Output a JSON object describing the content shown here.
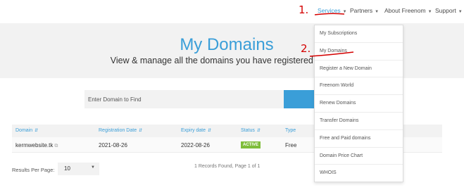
{
  "nav": {
    "services": "Services",
    "partners": "Partners",
    "about": "About Freenom",
    "support": "Support"
  },
  "hero": {
    "title": "My Domains",
    "subtitle": "View & manage all the domains you have registered with us"
  },
  "search": {
    "placeholder": "Enter Domain to Find"
  },
  "table": {
    "columns": [
      "Domain",
      "Registration Date",
      "Expiry date",
      "Status",
      "Type"
    ],
    "rows": [
      {
        "domain": "kermwebsite.tk",
        "registration_date": "2021-08-26",
        "expiry_date": "2022-08-26",
        "status": "ACTIVE",
        "type": "Free"
      }
    ]
  },
  "footer": {
    "results_per_page_label": "Results Per Page:",
    "results_per_page_value": "10",
    "records_text": "1 Records Found, Page 1 of 1"
  },
  "services_menu": {
    "items": [
      "My Subscriptions",
      "My Domains",
      "Register a New Domain",
      "Freenom World",
      "Renew Domains",
      "Transfer Domains",
      "Free and Paid domains",
      "Domain Price Chart",
      "WHOIS"
    ]
  },
  "annotations": {
    "step1": "1.",
    "step2": "2."
  },
  "colors": {
    "accent": "#3a9ed8",
    "active_badge": "#7fbd3a",
    "annotation": "#d40000"
  }
}
